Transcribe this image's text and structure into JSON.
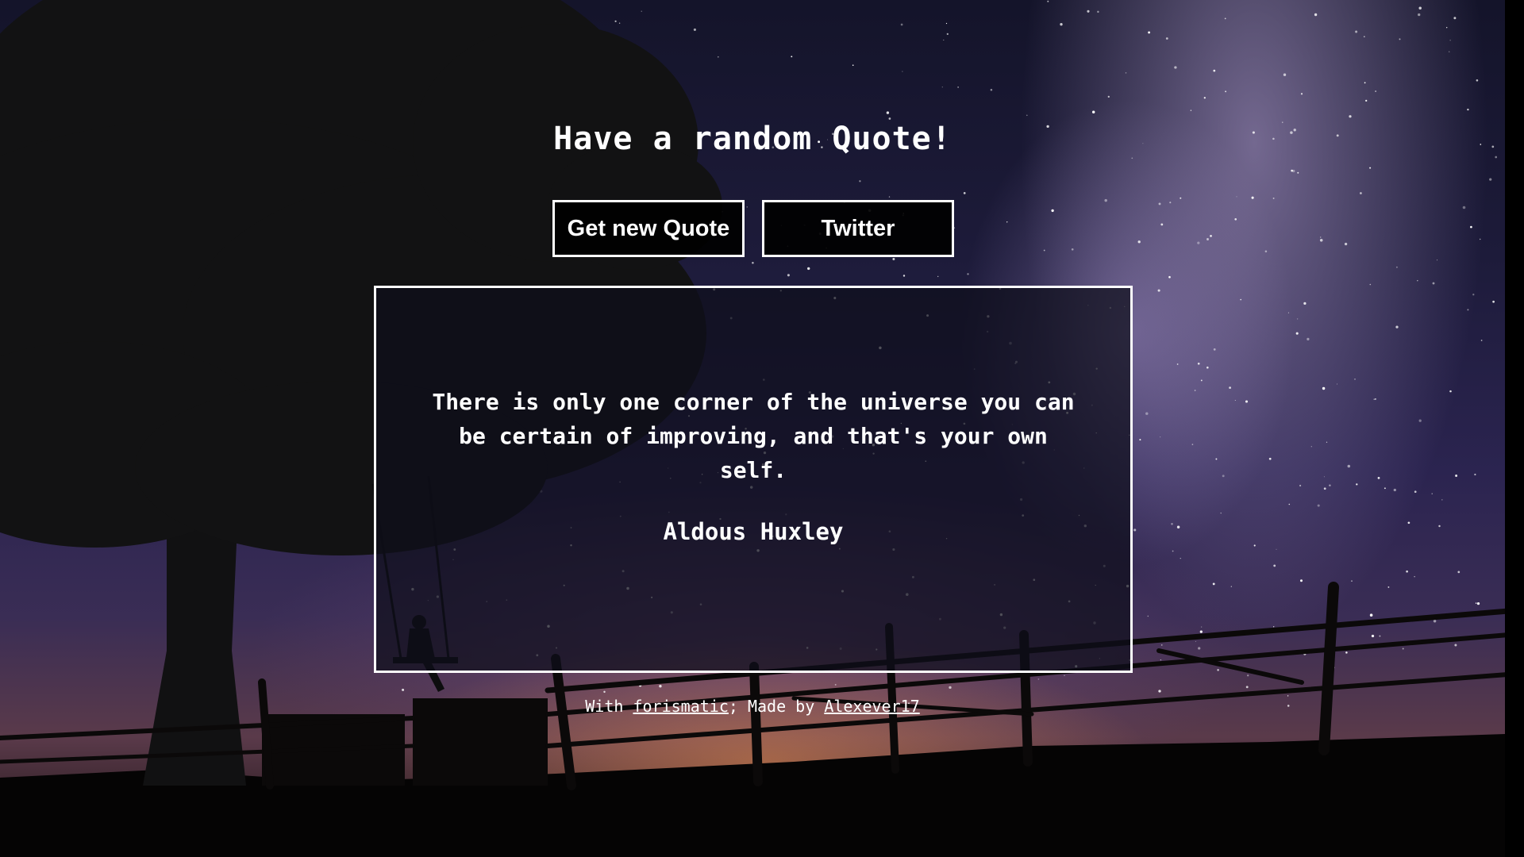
{
  "header": {
    "title": "Have a random Quote!"
  },
  "buttons": {
    "new_quote_label": "Get new Quote",
    "twitter_label": "Twitter"
  },
  "quote": {
    "text": "There is only one corner of the universe you can be certain of improving, and that's your own self.",
    "author": "Aldous Huxley"
  },
  "footer": {
    "prefix": "With",
    "source_link": "forismatic",
    "middle": "; Made by",
    "author_link": "Alexever17"
  },
  "colors": {
    "text": "#ffffff",
    "button_border": "#ffffff",
    "button_background": "#000000"
  },
  "background": {
    "scene": "night-sky-milky-way",
    "foreground": "tree-silhouette-swing-fence"
  }
}
